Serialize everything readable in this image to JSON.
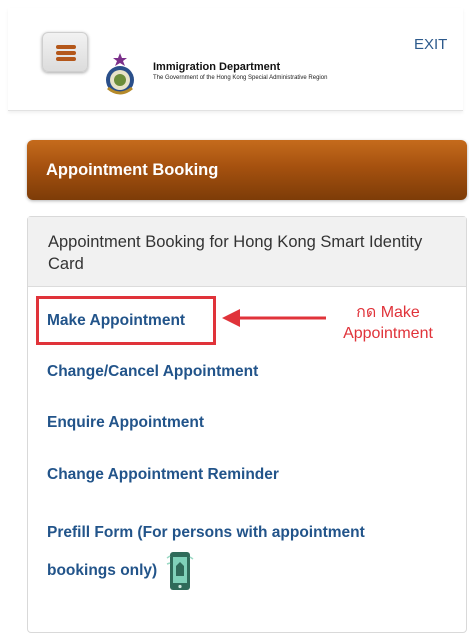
{
  "header": {
    "dept_name": "Immigration Department",
    "dept_subtitle": "The Government of the Hong Kong Special Administrative Region",
    "exit_label": "EXIT",
    "menu_icon": "hamburger-menu-icon",
    "logo_icon": "immigration-emblem-icon"
  },
  "section": {
    "title": "Appointment Booking"
  },
  "panel": {
    "title": "Appointment Booking for Hong Kong Smart Identity Card",
    "links": {
      "make": "Make Appointment",
      "change_cancel": "Change/Cancel Appointment",
      "enquire": "Enquire Appointment",
      "reminder": "Change Appointment Reminder",
      "prefill": "Prefill Form (For persons with appointment bookings only)"
    }
  },
  "annotation": {
    "line1": "กด Make",
    "line2": "Appointment"
  },
  "colors": {
    "accent": "#b4571a",
    "link": "#22548a",
    "annotation": "#e0333a",
    "section_bar": "#a5510f"
  }
}
